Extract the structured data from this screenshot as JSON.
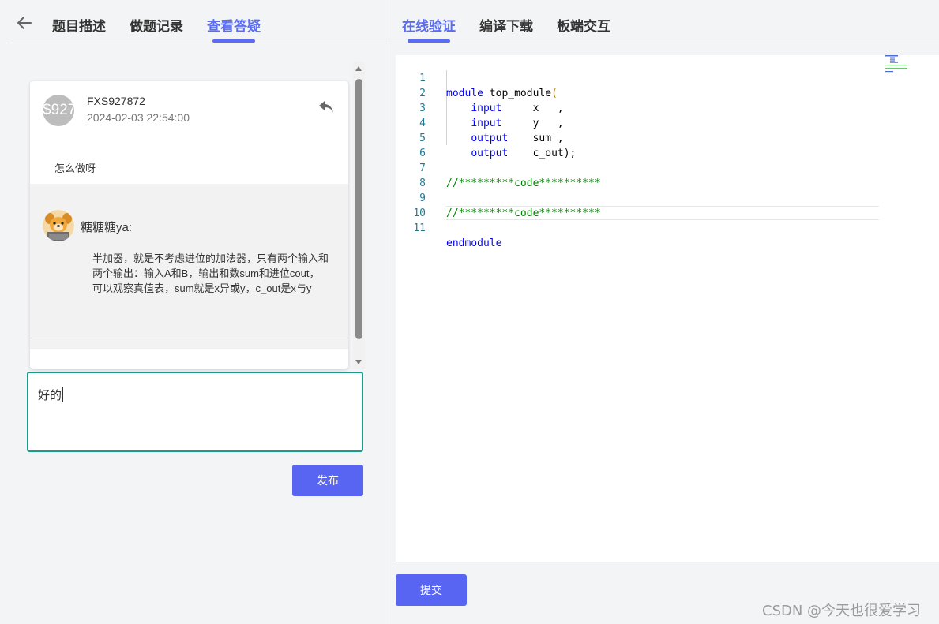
{
  "left_tabs": [
    {
      "label": "题目描述",
      "active": false
    },
    {
      "label": "做题记录",
      "active": false
    },
    {
      "label": "查看答疑",
      "active": true
    }
  ],
  "right_tabs": [
    {
      "label": "在线验证",
      "active": true
    },
    {
      "label": "编译下载",
      "active": false
    },
    {
      "label": "板端交互",
      "active": false
    }
  ],
  "question": {
    "avatar_text": "$927",
    "username": "FXS927872",
    "time": "2024-02-03 22:54:00",
    "body": "怎么做呀",
    "reply_icon": "reply-arrow-icon"
  },
  "answer": {
    "username": "糖糖糖ya:",
    "body": "半加器，就是不考虑进位的加法器，只有两个输入和两个输出：输入A和B，输出和数sum和进位cout，可以观察真值表，sum就是x异或y，c_out是x与y"
  },
  "reply_input": {
    "value": "好的"
  },
  "publish_label": "发布",
  "submit_label": "提交",
  "editor": {
    "lines": [
      {
        "n": "1",
        "text": "module top_module("
      },
      {
        "n": "2",
        "text": "    input     x   ,"
      },
      {
        "n": "3",
        "text": "    input     y   ,"
      },
      {
        "n": "4",
        "text": "    output    sum ,"
      },
      {
        "n": "5",
        "text": "    output    c_out);"
      },
      {
        "n": "6",
        "text": ""
      },
      {
        "n": "7",
        "text": "//*********code**********"
      },
      {
        "n": "8",
        "text": ""
      },
      {
        "n": "9",
        "text": "//*********code**********"
      },
      {
        "n": "10",
        "text": ""
      },
      {
        "n": "11",
        "text": "endmodule"
      }
    ]
  },
  "watermark": "CSDN @今天也很爱学习",
  "colors": {
    "accent": "#5a6cf0",
    "button": "#5865f2",
    "input_border": "#1b9b8a"
  }
}
